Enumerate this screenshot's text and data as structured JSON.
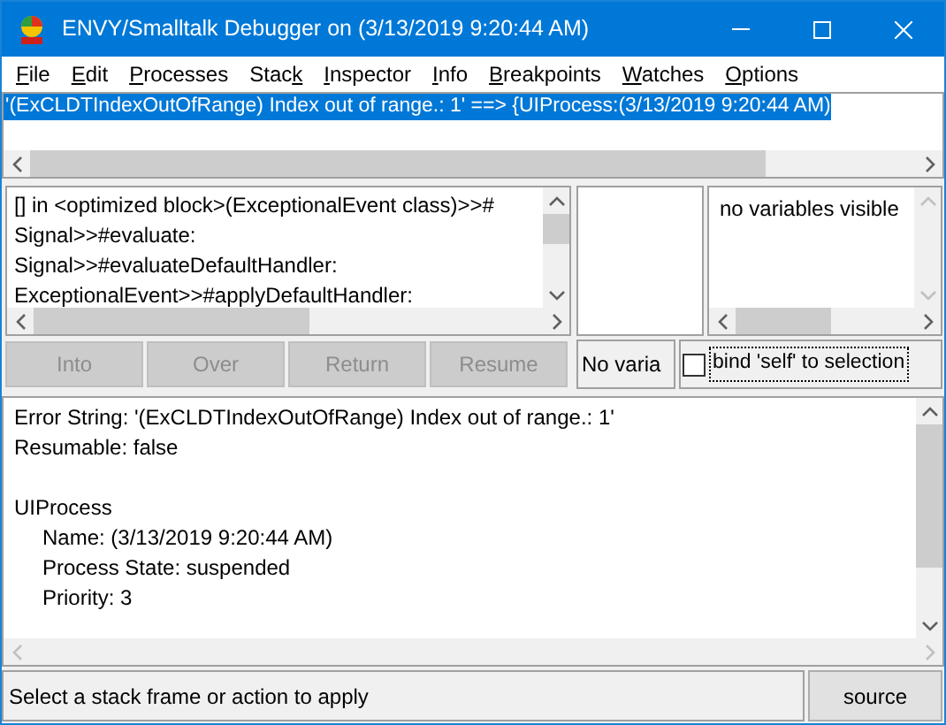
{
  "window": {
    "title": "ENVY/Smalltalk Debugger on (3/13/2019 9:20:44 AM)"
  },
  "menu": [
    {
      "underlined": "F",
      "rest": "ile"
    },
    {
      "underlined": "E",
      "rest": "dit"
    },
    {
      "underlined": "P",
      "rest": "rocesses"
    },
    {
      "lead": "Stac",
      "underlined": "k"
    },
    {
      "underlined": "I",
      "rest": "nspector"
    },
    {
      "underlined": "I",
      "rest": "nfo"
    },
    {
      "underlined": "B",
      "rest": "reakpoints"
    },
    {
      "underlined": "W",
      "rest": "atches"
    },
    {
      "underlined": "O",
      "rest": "ptions"
    }
  ],
  "processes": [
    {
      "text": "'(ExCLDTIndexOutOfRange) Index out of range.: 1' ==> {UIProcess:(3/13/2019 9:20:44 AM)",
      "selected": true
    }
  ],
  "stack": [
    {
      "text": "[] in <optimized block>(ExceptionalEvent class)>>#"
    },
    {
      "text": "Signal>>#evaluate:"
    },
    {
      "text": "Signal>>#evaluateDefaultHandler:"
    },
    {
      "text": "ExceptionalEvent>>#applyDefaultHandler:"
    }
  ],
  "buttons": [
    {
      "label": "Into",
      "disabled": true
    },
    {
      "label": "Over",
      "disabled": true
    },
    {
      "label": "Return",
      "disabled": true
    },
    {
      "label": "Resume",
      "disabled": true
    }
  ],
  "variables": {
    "text": "no variables visible"
  },
  "variable_field": {
    "value": "No varia"
  },
  "bind_self": {
    "label": "bind 'self' to selection",
    "checked": false
  },
  "details": [
    {
      "text": "Error String: '(ExCLDTIndexOutOfRange) Index out of range.: 1'"
    },
    {
      "text": "Resumable: false"
    },
    {
      "text": "UIProcess",
      "children": [
        {
          "text": "Name: (3/13/2019 9:20:44 AM)"
        },
        {
          "text": "Process State: suspended"
        },
        {
          "text": "Priority: 3"
        }
      ]
    }
  ],
  "status_bar": {
    "text": "Select a stack frame or action to apply",
    "button": "source"
  }
}
